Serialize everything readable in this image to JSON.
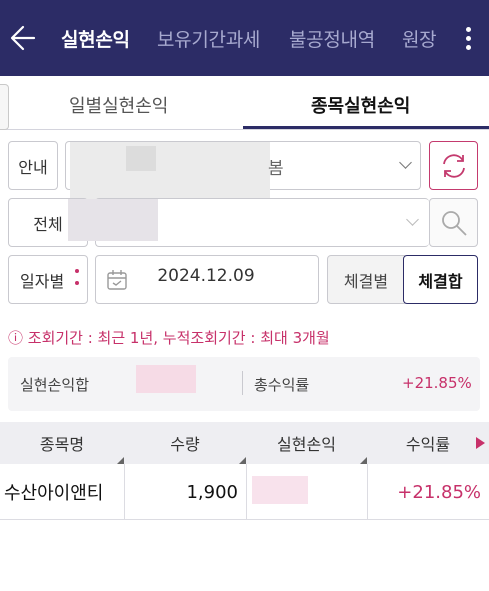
{
  "header": {
    "tabs": [
      {
        "label": "실현손익",
        "active": true
      },
      {
        "label": "보유기간과세",
        "active": false
      },
      {
        "label": "불공정내역",
        "active": false
      },
      {
        "label": "원장",
        "active": false
      }
    ],
    "bg_color": "#2c2c66"
  },
  "subtabs": [
    {
      "label": "일별실현손익",
      "active": false
    },
    {
      "label": "종목실현손익",
      "active": true
    }
  ],
  "filters": {
    "guide_label": "안내",
    "account_suffix": "봄",
    "all_label": "전체",
    "period_label": "일자별",
    "date_value": "2024.12.09",
    "exec_by_label": "체결별",
    "exec_sum_label": "체결합"
  },
  "notice": "ⓘ 조회기간 : 최근 1년, 누적조회기간 : 최대 3개월",
  "summary": {
    "realized_total_label": "실현손익합",
    "total_return_label": "총수익률",
    "total_return_value": "+21.85%"
  },
  "table": {
    "columns": [
      "종목명",
      "수량",
      "실현손익",
      "수익률"
    ],
    "rows": [
      {
        "name": "수산아이앤티",
        "qty": "1,900",
        "return": "+21.85%"
      }
    ]
  },
  "colors": {
    "accent": "#c7316a",
    "header": "#2c2c66"
  }
}
